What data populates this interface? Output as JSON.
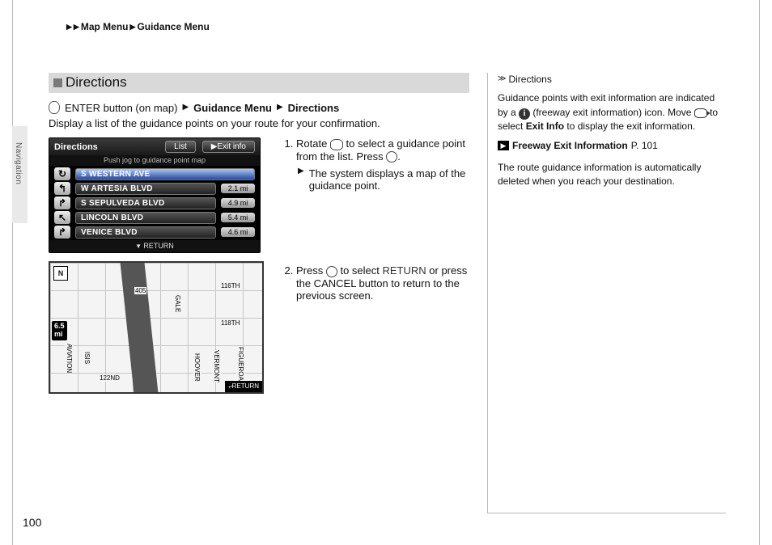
{
  "breadcrumb": {
    "level1": "Map Menu",
    "level2": "Guidance Menu"
  },
  "sidetab": "Navigation",
  "section_title": "Directions",
  "path": {
    "enter": "ENTER button (on map)",
    "p1": "Guidance Menu",
    "p2": "Directions"
  },
  "desc": "Display a list of the guidance points on your route for your confirmation.",
  "screenshot": {
    "title": "Directions",
    "btn_list": "List",
    "btn_exit": "▶Exit info",
    "subline": "Push jog to guidance point map",
    "rows": [
      {
        "arrow": "↻",
        "name": "S WESTERN AVE",
        "dist": "",
        "sel": true
      },
      {
        "arrow": "↰",
        "name": "W ARTESIA BLVD",
        "dist": "2.1 mi",
        "sel": false
      },
      {
        "arrow": "↱",
        "name": "S SEPULVEDA BLVD",
        "dist": "4.9 mi",
        "sel": false
      },
      {
        "arrow": "↖",
        "name": "LINCOLN BLVD",
        "dist": "5.4 mi",
        "sel": false
      },
      {
        "arrow": "↱",
        "name": "VENICE BLVD",
        "dist": "4.6 mi",
        "sel": false
      }
    ],
    "return": "RETURN"
  },
  "map": {
    "compass": "N",
    "distance": "6.5",
    "distance_unit": "mi",
    "labels": {
      "r116": "116TH",
      "r118": "118TH",
      "r122": "122ND",
      "isis": "ISIS",
      "aviation": "AVIATION",
      "gale": "GALE",
      "hoover": "HOOVER",
      "vermont": "VERMONT",
      "figueroa": "FIGUEROA",
      "hwy": "405"
    },
    "return": "⤶RETURN"
  },
  "steps": {
    "s1a": "Rotate ",
    "s1b": " to select a guidance point from the list. Press ",
    "s1c": ".",
    "s1sub": "The system displays a map of the guidance point.",
    "s2a": "Press ",
    "s2b": " to select ",
    "s2c": "RETURN",
    "s2d": " or press the CANCEL button to return to the previous screen."
  },
  "sidebar": {
    "title": "Directions",
    "p1a": "Guidance points with exit information are indicated by a ",
    "p1b": " (freeway exit information) icon. Move ",
    "p1c": " to select ",
    "p1_exit": "Exit Info",
    "p1d": " to display the exit information.",
    "ref_label": "Freeway Exit Information",
    "ref_page": "P. 101",
    "p2": "The route guidance information is automatically deleted when you reach your destination."
  },
  "page_number": "100"
}
